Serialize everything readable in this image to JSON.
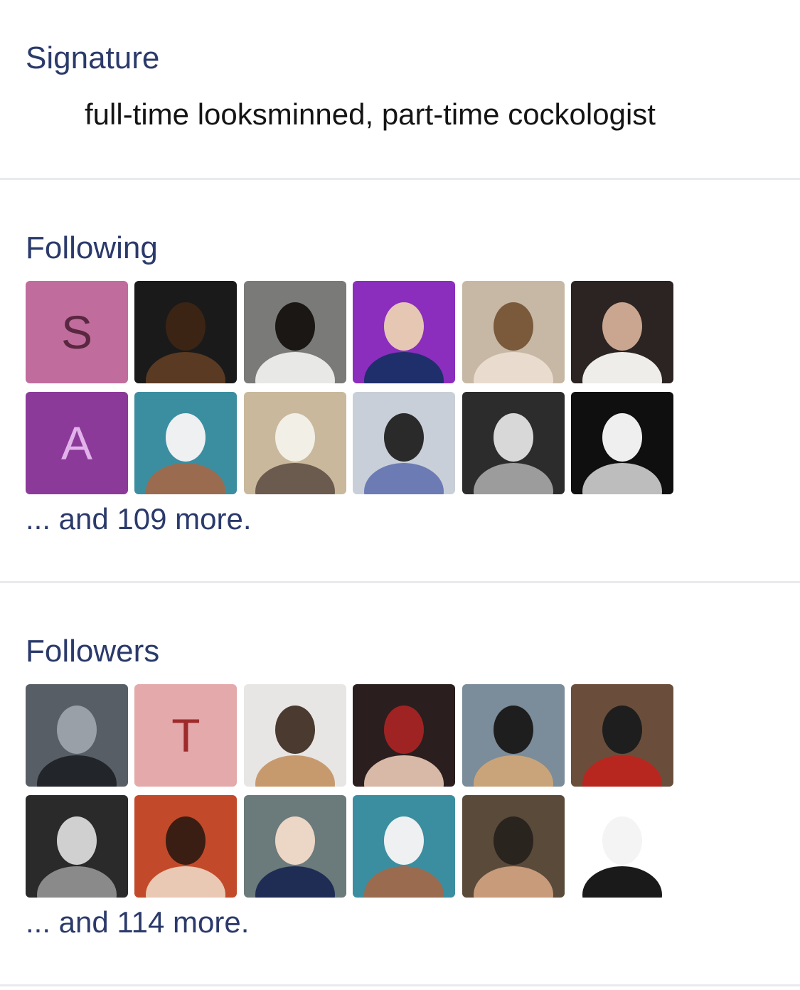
{
  "signature": {
    "heading": "Signature",
    "text": "full-time looksminned, part-time cockologist"
  },
  "following": {
    "heading": "Following",
    "more": "... and 109 more.",
    "avatars": [
      {
        "kind": "letter",
        "letter": "S",
        "bg": "#c06d9e",
        "fg": "#5a2740",
        "icon": "letter-avatar"
      },
      {
        "kind": "image",
        "icon": "cartoon-profile-face-photo",
        "palette": [
          "#1a1a1a",
          "#5a3a22",
          "#3c2414"
        ]
      },
      {
        "kind": "image",
        "icon": "person-white-cap-photo",
        "palette": [
          "#7a7a78",
          "#e8e8e6",
          "#1b1714"
        ]
      },
      {
        "kind": "image",
        "icon": "person-neon-purple-photo",
        "palette": [
          "#8b2dbd",
          "#1e2f6b",
          "#e6c7b4"
        ]
      },
      {
        "kind": "image",
        "icon": "person-car-seat-photo",
        "palette": [
          "#c7b8a5",
          "#e9dccf",
          "#7a5a3b"
        ]
      },
      {
        "kind": "image",
        "icon": "person-white-shirt-photo",
        "palette": [
          "#2b2422",
          "#efede9",
          "#caa58f"
        ]
      },
      {
        "kind": "letter",
        "letter": "A",
        "bg": "#8c3a9a",
        "fg": "#e1b3ea",
        "icon": "letter-avatar"
      },
      {
        "kind": "image",
        "icon": "person-holding-paper-photo",
        "palette": [
          "#3b8ea0",
          "#9a6b4f",
          "#eef0f2"
        ]
      },
      {
        "kind": "image",
        "icon": "bearded-scholar-painting",
        "palette": [
          "#c9b89c",
          "#6b5a4e",
          "#f2efe6"
        ]
      },
      {
        "kind": "image",
        "icon": "penguin-loading-photo",
        "palette": [
          "#c9cfd8",
          "#6c7bb4",
          "#2a2a2a"
        ]
      },
      {
        "kind": "image",
        "icon": "pig-night-camera-photo",
        "palette": [
          "#2c2c2c",
          "#9c9c9c",
          "#d8d8d8"
        ]
      },
      {
        "kind": "image",
        "icon": "bw-portrait-photo",
        "palette": [
          "#0f0f0f",
          "#bdbdbd",
          "#efefef"
        ]
      }
    ]
  },
  "followers": {
    "heading": "Followers",
    "more": "... and 114 more.",
    "avatars": [
      {
        "kind": "image",
        "icon": "helicopter-sports-car-photo",
        "palette": [
          "#585e66",
          "#22252a",
          "#9aa0a8"
        ]
      },
      {
        "kind": "letter",
        "letter": "T",
        "bg": "#e3a9ab",
        "fg": "#9e2b2b",
        "icon": "letter-avatar"
      },
      {
        "kind": "image",
        "icon": "puppy-bowtie-photo",
        "palette": [
          "#e8e6e4",
          "#c79a6e",
          "#4a3a30"
        ]
      },
      {
        "kind": "image",
        "icon": "anime-character-photo",
        "palette": [
          "#2b1e1e",
          "#d8b9a8",
          "#a02323"
        ]
      },
      {
        "kind": "image",
        "icon": "person-straw-hat-cat-photo",
        "palette": [
          "#7b8c9a",
          "#c9a47b",
          "#1e1e1e"
        ]
      },
      {
        "kind": "image",
        "icon": "person-glasses-red-shirt-photo",
        "palette": [
          "#6a4e3b",
          "#b8271f",
          "#1e1e1e"
        ]
      },
      {
        "kind": "image",
        "icon": "bw-smoking-man-photo",
        "palette": [
          "#2a2a2a",
          "#8a8a8a",
          "#d0d0d0"
        ]
      },
      {
        "kind": "image",
        "icon": "person-red-carpet-photo",
        "palette": [
          "#c24a2a",
          "#e9c9b3",
          "#3a1e14"
        ]
      },
      {
        "kind": "image",
        "icon": "smiling-man-suit-photo",
        "palette": [
          "#6b7a7a",
          "#1f2d55",
          "#ecd6c6"
        ]
      },
      {
        "kind": "image",
        "icon": "person-holding-paper-photo",
        "palette": [
          "#3b8ea0",
          "#9a6b4f",
          "#eef0f2"
        ]
      },
      {
        "kind": "image",
        "icon": "man-cigar-photo",
        "palette": [
          "#5a4a3a",
          "#c89b7b",
          "#2a241f"
        ]
      },
      {
        "kind": "image",
        "icon": "meme-face-drawing",
        "palette": [
          "#ffffff",
          "#1a1a1a",
          "#f4f4f4"
        ]
      }
    ]
  }
}
